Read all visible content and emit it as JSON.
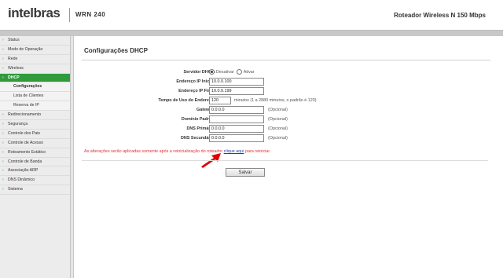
{
  "header": {
    "logo": "intelbras",
    "model": "WRN 240",
    "product": "Roteador Wireless N 150 Mbps"
  },
  "sidebar": {
    "items": [
      {
        "label": "Status",
        "kind": "top"
      },
      {
        "label": "Modo de Operação",
        "kind": "top"
      },
      {
        "label": "Rede",
        "kind": "top"
      },
      {
        "label": "Wireless",
        "kind": "top"
      },
      {
        "label": "DHCP",
        "kind": "active"
      },
      {
        "label": "Configurações",
        "kind": "sub-active"
      },
      {
        "label": "Lista de Clientes",
        "kind": "sub"
      },
      {
        "label": "Reserva de IP",
        "kind": "sub"
      },
      {
        "label": "Redirecionamento",
        "kind": "top"
      },
      {
        "label": "Segurança",
        "kind": "top"
      },
      {
        "label": "Controle dos Pais",
        "kind": "top"
      },
      {
        "label": "Controle de Acesso",
        "kind": "top"
      },
      {
        "label": "Roteamento Estático",
        "kind": "top"
      },
      {
        "label": "Controle de Banda",
        "kind": "top"
      },
      {
        "label": "Associação ARP",
        "kind": "top"
      },
      {
        "label": "DNS Dinâmico",
        "kind": "top"
      },
      {
        "label": "Sistema",
        "kind": "top"
      }
    ]
  },
  "page": {
    "title": "Configurações DHCP",
    "server_label": "Servidor DHCP:",
    "server_option_off": "Desativar",
    "server_option_on": "Ativar",
    "server_selected": "Desativar",
    "fields": {
      "ip_start": {
        "label": "Endereço IP Inicial:",
        "value": "10.0.0.100"
      },
      "ip_end": {
        "label": "Endereço IP Final:",
        "value": "10.0.0.199"
      },
      "lease": {
        "label": "Tempo de Uso do Endereço:",
        "value": "120",
        "hint": "minutos (1 a 2880 minutos, o padrão é 120)"
      },
      "gateway": {
        "label": "Gateway:",
        "value": "0.0.0.0",
        "hint": "(Opcional)"
      },
      "domain": {
        "label": "Domínio Padrão:",
        "value": "",
        "hint": "(Opcional)"
      },
      "dns1": {
        "label": "DNS Primário:",
        "value": "0.0.0.0",
        "hint": "(Opcional)"
      },
      "dns2": {
        "label": "DNS Secundário:",
        "value": "0.0.0.0",
        "hint": "(Opcional)"
      }
    },
    "note_prefix": "As alterações serão aplicadas somente após a reinicialização do roteador ",
    "note_link": "clique aqui",
    "note_suffix": " para reiniciar.",
    "save_label": "Salvar"
  },
  "colors": {
    "accent": "#2f9b3b",
    "note": "#e03030",
    "link": "#1d3fa8",
    "arrow": "#e00000"
  },
  "icons": [
    "chevron-right-icon",
    "red-arrow-icon"
  ]
}
